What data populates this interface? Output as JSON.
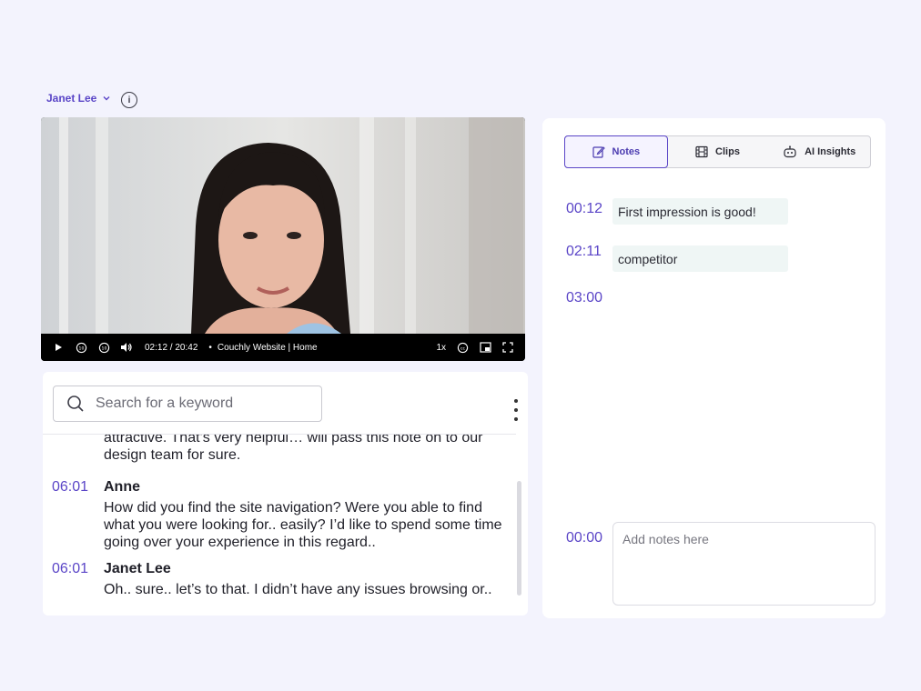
{
  "header": {
    "user_name": "Janet Lee",
    "info_icon": "info-icon"
  },
  "video": {
    "time": "02:12 / 20:42",
    "separator": "•",
    "title": "Couchly Website | Home",
    "rate": "1x",
    "icons": [
      "play-icon",
      "rewind-10-icon",
      "forward-10-icon",
      "volume-icon",
      "captions-icon",
      "picture-in-picture-icon",
      "fullscreen-icon"
    ]
  },
  "transcript": {
    "search_placeholder": "Search for a keyword",
    "lead_text": "attractive. That’s very helpful… will pass this note on to our design team for sure.",
    "entries": [
      {
        "time": "06:01",
        "speaker": "Anne",
        "text": "How did you find the site navigation? Were you able to find what you were looking for.. easily? I’d like to spend some time going over your experience in this regard.."
      },
      {
        "time": "06:01",
        "speaker": "Janet Lee",
        "text": "Oh.. sure.. let’s to that. I didn’t have any issues browsing or.."
      }
    ]
  },
  "notes_panel": {
    "tabs": [
      {
        "label": "Notes",
        "icon": "edit-note-icon",
        "active": true
      },
      {
        "label": "Clips",
        "icon": "film-icon",
        "active": false
      },
      {
        "label": "AI Insights",
        "icon": "robot-icon",
        "active": false
      }
    ],
    "notes": [
      {
        "time": "00:12",
        "text": "First impression is good!"
      },
      {
        "time": "02:11",
        "text": "competitor"
      },
      {
        "time": "03:00",
        "text": ""
      }
    ],
    "new_note": {
      "time": "00:00",
      "placeholder": "Add notes here"
    }
  },
  "colors": {
    "accent": "#5a45c7",
    "background": "#f3f3fd",
    "note_chip": "#eff6f5"
  }
}
